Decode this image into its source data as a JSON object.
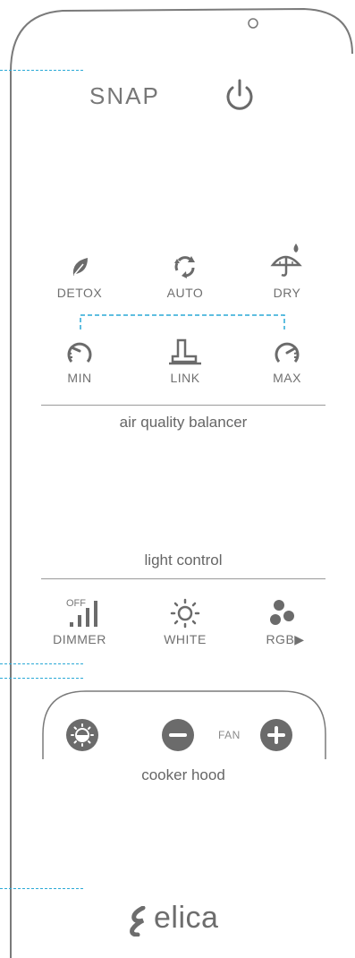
{
  "remote": {
    "brand": "SNAP",
    "power_icon": "power-icon",
    "led_icon": "led-indicator-icon"
  },
  "modes": [
    {
      "label": "DETOX",
      "icon": "leaf-icon"
    },
    {
      "label": "AUTO",
      "icon": "recycle-arrows-icon"
    },
    {
      "label": "DRY",
      "icon": "umbrella-drop-icon"
    }
  ],
  "levels": [
    {
      "label": "MIN",
      "icon": "gauge-min-icon"
    },
    {
      "label": "LINK",
      "icon": "hood-icon"
    },
    {
      "label": "MAX",
      "icon": "gauge-max-icon"
    }
  ],
  "air_quality": {
    "title": "air quality balancer"
  },
  "light": {
    "title": "light control",
    "dimmer": {
      "label": "DIMMER",
      "off_label": "OFF",
      "icon": "signal-bars-icon"
    },
    "white": {
      "label": "WHITE",
      "icon": "sun-icon"
    },
    "rgb": {
      "label": "RGB",
      "arrow": "▶",
      "icon": "three-dots-icon"
    }
  },
  "hood": {
    "title": "cooker hood",
    "fan_label": "FAN",
    "light_icon": "hood-light-icon",
    "minus_icon": "minus-icon",
    "plus_icon": "plus-icon"
  },
  "logo": {
    "text": "elica",
    "icon": "elica-flame-icon"
  },
  "colors": {
    "accent_dash": "#2aa9d6",
    "gray": "#6b6b6b"
  }
}
